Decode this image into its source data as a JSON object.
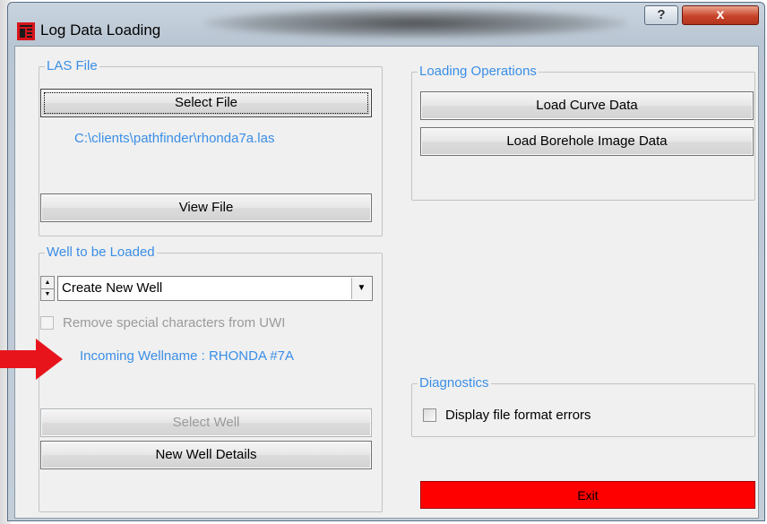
{
  "window": {
    "title": "Log Data Loading",
    "help_glyph": "?",
    "close_glyph": "x"
  },
  "las_file": {
    "legend": "LAS File",
    "select_file_label": "Select File",
    "file_path": "C:\\clients\\pathfinder\\rhonda7a.las",
    "view_file_label": "View File"
  },
  "well": {
    "legend": "Well to be Loaded",
    "combo_value": "Create New Well",
    "remove_special_label": "Remove special characters from UWI",
    "remove_special_checked": false,
    "incoming_wellname": "Incoming Wellname : RHONDA #7A",
    "select_well_label": "Select Well",
    "new_well_details_label": "New Well Details"
  },
  "loading_operations": {
    "legend": "Loading Operations",
    "load_curve_label": "Load Curve Data",
    "load_borehole_label": "Load Borehole Image Data"
  },
  "diagnostics": {
    "legend": "Diagnostics",
    "display_errors_label": "Display file format errors",
    "display_errors_checked": false
  },
  "exit_label": "Exit",
  "colors": {
    "accent_text": "#3a8ee6",
    "exit_button": "#ff0000",
    "annotation_arrow": "#e8141c"
  }
}
